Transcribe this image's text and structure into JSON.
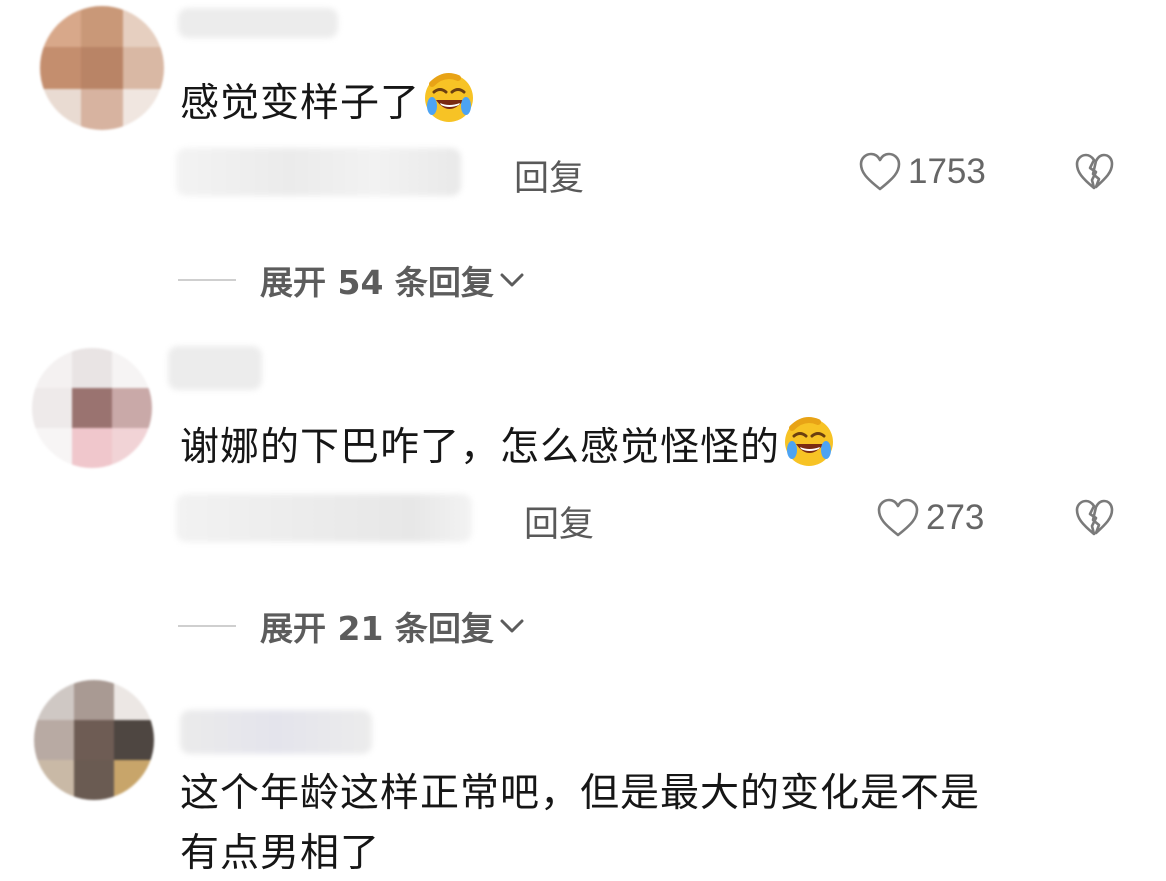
{
  "comments": [
    {
      "text": "感觉变样子了",
      "emoji": "laughing-tears-emoji",
      "reply_label": "回复",
      "like_count": "1753",
      "expand_label": "展开 54 条回复"
    },
    {
      "text": "谢娜的下巴咋了，怎么感觉怪怪的",
      "emoji": "laughing-tears-emoji",
      "reply_label": "回复",
      "like_count": "273",
      "expand_label": "展开 21 条回复"
    },
    {
      "text_line1": "这个年龄这样正常吧，但是最大的变化是不是",
      "text_line2": "有点男相了"
    }
  ],
  "icons": {
    "like": "heart-outline-icon",
    "dislike": "broken-heart-icon",
    "expand": "chevron-down-icon"
  },
  "colors": {
    "text": "#161616",
    "secondary": "#595959",
    "divider": "#cfcfcf"
  }
}
